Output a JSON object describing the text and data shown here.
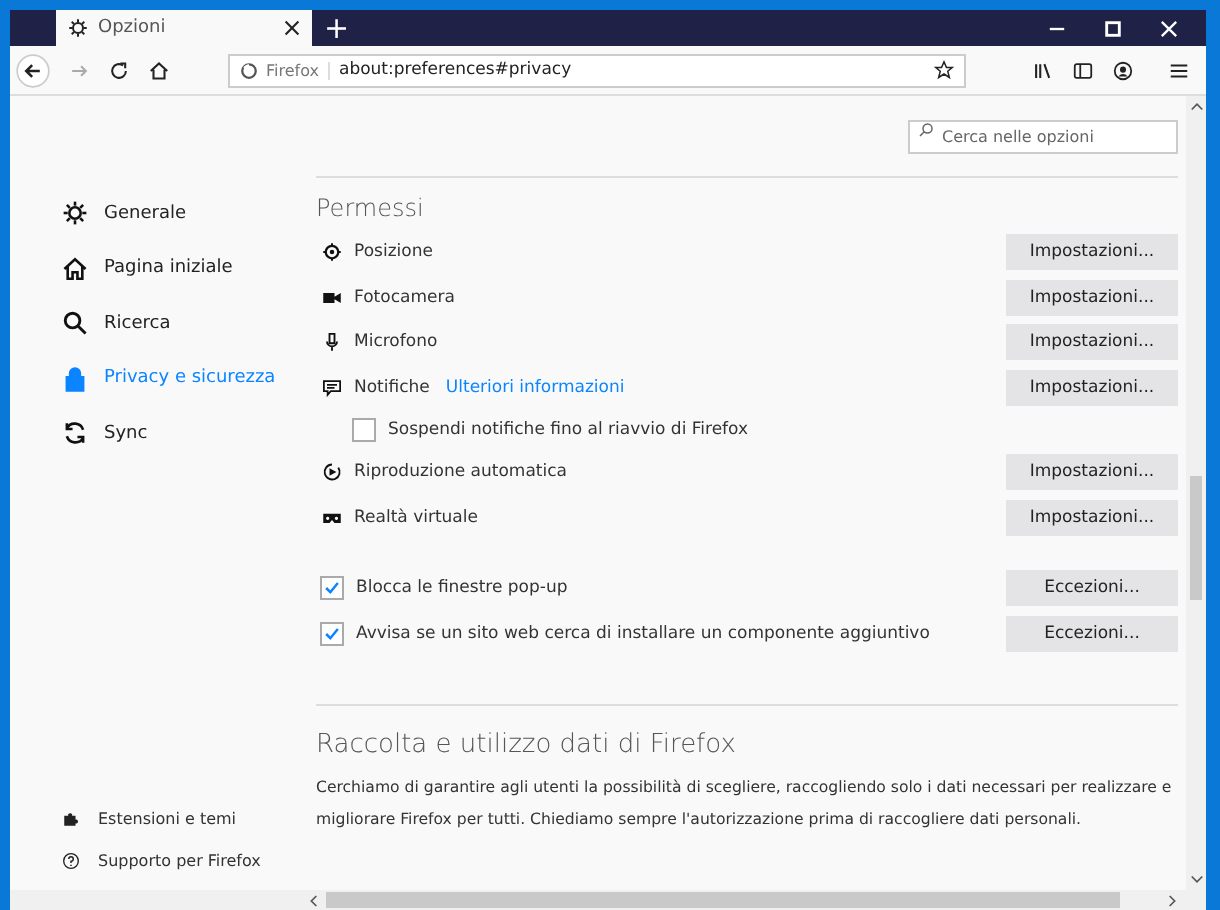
{
  "tab": {
    "title": "Opzioni",
    "new_tab": "+"
  },
  "address_bar": {
    "identity": "Firefox",
    "url": "about:preferences#privacy"
  },
  "search": {
    "placeholder": "Cerca nelle opzioni"
  },
  "sidebar": {
    "items": [
      {
        "label": "Generale",
        "selected": false
      },
      {
        "label": "Pagina iniziale",
        "selected": false
      },
      {
        "label": "Ricerca",
        "selected": false
      },
      {
        "label": "Privacy e sicurezza",
        "selected": true
      },
      {
        "label": "Sync",
        "selected": false
      }
    ],
    "footer": [
      "Estensioni e temi",
      "Supporto per Firefox"
    ]
  },
  "permissions": {
    "title": "Permessi",
    "rows": [
      {
        "kind": "permission",
        "label": "Posizione",
        "button": "Impostazioni..."
      },
      {
        "kind": "permission",
        "label": "Fotocamera",
        "button": "Impostazioni..."
      },
      {
        "kind": "permission",
        "label": "Microfono",
        "button": "Impostazioni..."
      },
      {
        "kind": "permission",
        "label": "Notifiche",
        "link": "Ulteriori informazioni",
        "button": "Impostazioni..."
      },
      {
        "kind": "subcheck",
        "label": "Sospendi notifiche fino al riavvio di Firefox",
        "checked": false
      },
      {
        "kind": "permission",
        "label": "Riproduzione automatica",
        "button": "Impostazioni..."
      },
      {
        "kind": "permission",
        "label": "Realtà virtuale",
        "button": "Impostazioni..."
      },
      {
        "kind": "check",
        "label": "Blocca le finestre pop-up",
        "checked": true,
        "button": "Eccezioni..."
      },
      {
        "kind": "check",
        "label": "Avvisa se un sito web cerca di installare un componente aggiuntivo",
        "checked": true,
        "button": "Eccezioni..."
      }
    ]
  },
  "data_collection": {
    "title": "Raccolta e utilizzo dati di Firefox",
    "text": "Cerchiamo di garantire agli utenti la possibilità di scegliere, raccogliendo solo i dati necessari per realizzare e migliorare Firefox per tutti. Chiediamo sempre l'autorizzazione prima di raccogliere dati personali."
  }
}
